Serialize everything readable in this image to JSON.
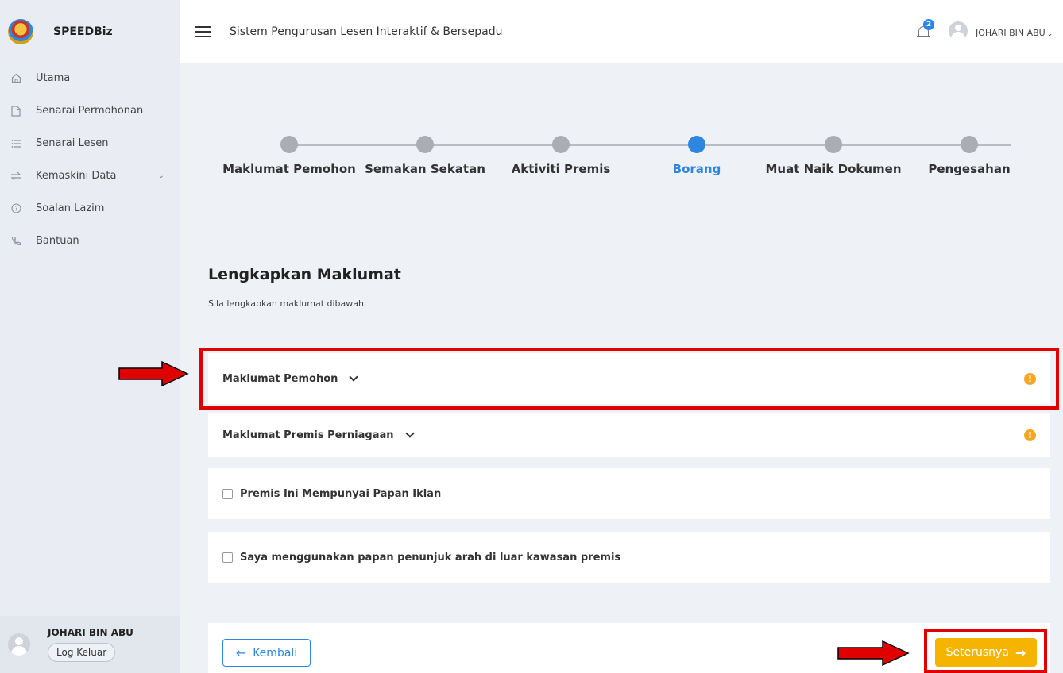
{
  "brand": {
    "name": "SPEEDBiz"
  },
  "sidebar": {
    "items": [
      {
        "label": "Utama",
        "icon": "home-icon"
      },
      {
        "label": "Senarai Permohonan",
        "icon": "document-icon"
      },
      {
        "label": "Senarai Lesen",
        "icon": "list-icon"
      },
      {
        "label": "Kemaskini Data",
        "icon": "sync-icon"
      },
      {
        "label": "Soalan Lazim",
        "icon": "help-icon"
      },
      {
        "label": "Bantuan",
        "icon": "phone-icon"
      }
    ],
    "user_name": "JOHARI BIN ABU",
    "logout_label": "Log Keluar"
  },
  "header": {
    "title": "Sistem Pengurusan Lesen Interaktif & Bersepadu",
    "notification_count": "2",
    "user_name": "JOHARI BIN ABU"
  },
  "stepper": {
    "steps": [
      {
        "label": "Maklumat Pemohon",
        "active": false
      },
      {
        "label": "Semakan Sekatan",
        "active": false
      },
      {
        "label": "Aktiviti Premis",
        "active": false
      },
      {
        "label": "Borang",
        "active": true
      },
      {
        "label": "Muat Naik Dokumen",
        "active": false
      },
      {
        "label": "Pengesahan",
        "active": false
      }
    ]
  },
  "main": {
    "title": "Lengkapkan Maklumat",
    "subtitle": "Sila lengkapkan maklumat dibawah.",
    "panels": [
      {
        "label": "Maklumat Pemohon",
        "warning": "!"
      },
      {
        "label": "Maklumat Premis Perniagaan",
        "warning": "!"
      }
    ],
    "checkboxes": [
      {
        "label": "Premis Ini Mempunyai Papan Iklan",
        "checked": false
      },
      {
        "label": "Saya menggunakan papan penunjuk arah di luar kawasan premis",
        "checked": false
      }
    ]
  },
  "footer": {
    "back_label": "Kembali",
    "next_label": "Seterusnya"
  },
  "colors": {
    "accent": "#2e86de",
    "warning": "#f5a623",
    "next_button": "#f5b400",
    "annotation": "#e00000"
  }
}
